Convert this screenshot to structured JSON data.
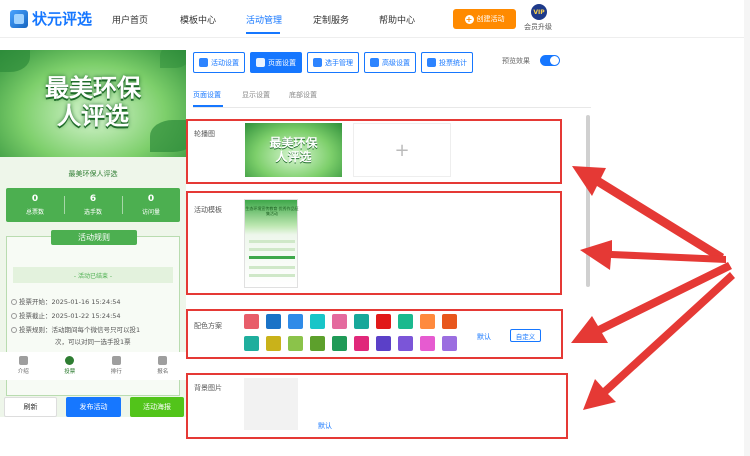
{
  "header": {
    "logo_text": "状元评选",
    "nav": [
      "用户首页",
      "模板中心",
      "活动管理",
      "定制服务",
      "帮助中心"
    ],
    "active_nav": "活动管理",
    "create_button": "创建活动",
    "vip_badge": "VIP",
    "vip_label": "会员升级"
  },
  "preview": {
    "banner_title_line1": "最美环保",
    "banner_title_line2": "人评选",
    "activity_name": "最美环保人评选",
    "stats": [
      {
        "value": "0",
        "label": "总票数"
      },
      {
        "value": "6",
        "label": "选手数"
      },
      {
        "value": "0",
        "label": "访问量"
      }
    ],
    "rules_title": "活动规则",
    "ended_text": "- 活动已结束 -",
    "rules": [
      "投票开始：2025-01-16 15:24:54",
      "投票截止：2025-01-22 15:24:54",
      "投票规则：活动期间每个微信号只可以投1"
    ],
    "rules_continued": "次，可以对同一选手投1票",
    "tabs": [
      "介绍",
      "投票",
      "排行",
      "报名"
    ],
    "buttons": {
      "refresh": "刷新",
      "publish": "发布活动",
      "poster": "活动海报"
    }
  },
  "toolbar": {
    "buttons": [
      "活动设置",
      "页面设置",
      "选手管理",
      "高级设置",
      "投票统计"
    ],
    "active": "页面设置",
    "preview_label": "预览效果",
    "preview_enabled": true
  },
  "subtabs": [
    "页面设置",
    "显示设置",
    "底部设置"
  ],
  "sections": {
    "carousel_label": "轮播图",
    "carousel_image_line1": "最美环保",
    "carousel_image_line2": "人评选",
    "carousel_add": "+",
    "template_label": "活动模板",
    "template_thumb_text": "生态环境宣传教育 优秀作品征集活动",
    "color_label": "配色方案",
    "color_default": "默认",
    "color_custom": "自定义",
    "bg_label": "背景图片",
    "bg_default": "默认"
  },
  "palette": {
    "row1": [
      "#e85d6a",
      "#1a73c7",
      "#2f8be8",
      "#18c5c8",
      "#e46a9e",
      "#17a89a",
      "#e11919",
      "#1bb98e",
      "#ff8a3d",
      "#e8571d"
    ],
    "row2": [
      "#1fae9d",
      "#c9b21a",
      "#8bc34a",
      "#5da02c",
      "#1f9a57",
      "#e0287a",
      "#5b40c8",
      "#7b55d8",
      "#e65bd0",
      "#9b6ee0"
    ]
  },
  "annotation_color": "#e53935",
  "accent_color": "#1677ff"
}
